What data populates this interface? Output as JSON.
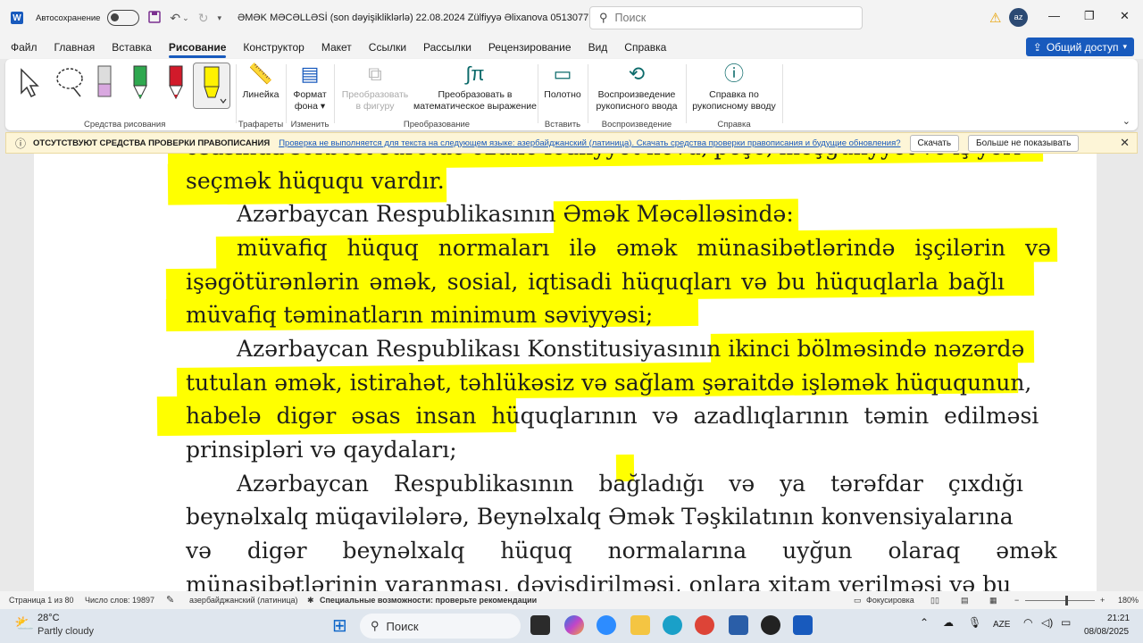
{
  "titlebar": {
    "app_logo": "W",
    "autosave_label": "Автосохранение",
    "doc_title": "ƏMƏK MƏCƏLLƏSİ (son dəyişikliklərlə) 22.08.2024 Zülfiyyə Əlixanova 0513077...",
    "search_placeholder": "Поиск",
    "avatar_initials": "az"
  },
  "menu": {
    "tabs": [
      "Файл",
      "Главная",
      "Вставка",
      "Рисование",
      "Конструктор",
      "Макет",
      "Ссылки",
      "Рассылки",
      "Рецензирование",
      "Вид",
      "Справка"
    ],
    "active_tab": "Рисование",
    "share_label": "Общий доступ"
  },
  "ribbon": {
    "groups": {
      "drawing_tools": "Средства рисования",
      "stencils": "Трафареты",
      "change": "Изменить",
      "convert": "Преобразование",
      "insert": "Вставить",
      "replay": "Воспроизведение",
      "help": "Справка"
    },
    "buttons": {
      "ruler": "Линейка",
      "background_format_1": "Формат",
      "background_format_2": "фона",
      "to_shape_1": "Преобразовать",
      "to_shape_2": "в фигуру",
      "to_math_1": "Преобразовать в",
      "to_math_2": "математическое выражение",
      "canvas": "Полотно",
      "ink_replay_1": "Воспроизведение",
      "ink_replay_2": "рукописного ввода",
      "ink_help_1": "Справка по",
      "ink_help_2": "рукописному вводу"
    }
  },
  "notification": {
    "title": "ОТСУТСТВУЮТ СРЕДСТВА ПРОВЕРКИ ПРАВОПИСАНИЯ",
    "message": "Проверка не выполняется для текста на следующем языке: азербайджанский (латиница). Скачать средства проверки правописания и будущие обновления?",
    "download_button": "Скачать",
    "dismiss_button": "Больше не показывать"
  },
  "document": {
    "lines": [
      "əsasında sərbəst surətdə özünə fəaliyyət növü, peşə, məşğuliyyət və iş yeri",
      "seçmək hüququ vardır.",
      "Azərbaycan Respublikasının Əmək Məcəlləsində:",
      "müvafiq hüquq normaları ilə əmək münasibətlərində işçilərin və",
      "işəgötürənlərin əmək, sosial, iqtisadi hüquqları və bu hüquqlarla bağlı",
      "müvafiq təminatların minimum səviyyəsi;",
      "Azərbaycan Respublikası Konstitusiyasının ikinci bölməsində nəzərdə",
      "tutulan əmək, istirahət, təhlükəsiz və sağlam şəraitdə işləmək hüququnun,",
      "habelə digər əsas insan hüquqlarının və azadlıqlarının təmin edilməsi",
      "prinsipləri və qaydaları;",
      "Azərbaycan Respublikasının bağladığı və ya tərəfdar çıxdığı",
      "beynəlxalq müqavilələrə, Beynəlxalq Əmək Təşkilatının konvensiyalarına",
      "və digər beynəlxalq hüquq normalarına uyğun olaraq əmək",
      "münasibətlərinin yaranması, dəyişdirilməsi, onlara xitam verilməsi və bu"
    ]
  },
  "statusbar": {
    "page": "Страница 1 из 80",
    "words": "Число слов: 19897",
    "language": "азербайджанский (латиница)",
    "accessibility": "Специальные возможности: проверьте рекомендации",
    "focus": "Фокусировка",
    "zoom": "180%"
  },
  "taskbar": {
    "temperature": "28°C",
    "weather": "Partly cloudy",
    "search_label": "Поиск",
    "language": "AZE",
    "time": "21:21",
    "date": "08/08/2025"
  },
  "colors": {
    "accent": "#185abd",
    "highlight": "#ffff00",
    "notification_bg": "#fdf5d7"
  }
}
